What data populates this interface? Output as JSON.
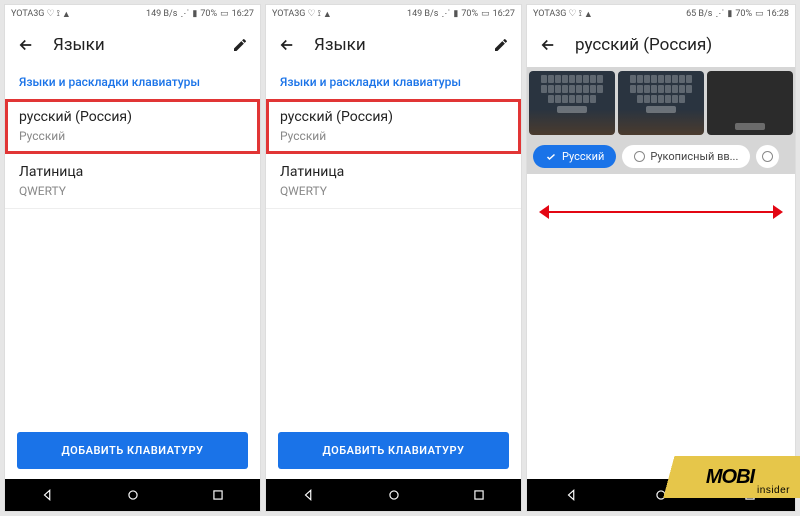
{
  "status": {
    "carrier": "YOTA3G",
    "speed1": "149 B/s",
    "speed2": "65 B/s",
    "battery": "70%",
    "time1": "16:27",
    "time2": "16:28"
  },
  "screen1": {
    "title": "Языки",
    "section_link": "Языки и раскладки клавиатуры",
    "item1_title": "русский (Россия)",
    "item1_sub": "Русский",
    "item2_title": "Латиница",
    "item2_sub": "QWERTY",
    "add_button": "ДОБАВИТЬ КЛАВИАТУРУ"
  },
  "screen3": {
    "title": "русский (Россия)",
    "chip1": "Русский",
    "chip2": "Рукописный вв..."
  },
  "watermark": {
    "brand": "MOBI",
    "sub": "insider"
  }
}
